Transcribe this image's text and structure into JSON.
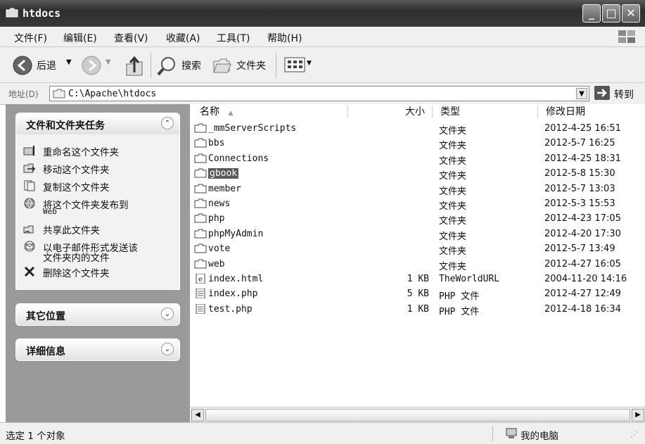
{
  "window": {
    "title": "htdocs"
  },
  "menu": [
    "文件(F)",
    "编辑(E)",
    "查看(V)",
    "收藏(A)",
    "工具(T)",
    "帮助(H)"
  ],
  "toolbar": {
    "back": "后退",
    "search": "搜索",
    "folders": "文件夹"
  },
  "address": {
    "label": "地址(D)",
    "value": "C:\\Apache\\htdocs",
    "go": "转到"
  },
  "tasks_panel": {
    "title": "文件和文件夹任务",
    "items": [
      {
        "label": "重命名这个文件夹",
        "icon": "rename-icon"
      },
      {
        "label": "移动这个文件夹",
        "icon": "move-icon"
      },
      {
        "label": "复制这个文件夹",
        "icon": "copy-icon"
      },
      {
        "label": "将这个文件夹发布到",
        "sub": "Web",
        "icon": "publish-web-icon"
      },
      {
        "label": "共享此文件夹",
        "icon": "share-icon"
      },
      {
        "label": "以电子邮件形式发送该",
        "label2": "文件夹内的文件",
        "icon": "email-icon"
      },
      {
        "label": "删除这个文件夹",
        "icon": "delete-icon"
      }
    ]
  },
  "other_places": {
    "title": "其它位置"
  },
  "details": {
    "title": "详细信息"
  },
  "columns": {
    "name": "名称",
    "size": "大小",
    "type": "类型",
    "modified": "修改日期"
  },
  "files": [
    {
      "name": "_mmServerScripts",
      "size": "",
      "type": "文件夹",
      "date": "2012-4-25 16:51",
      "icon": "folder-icon"
    },
    {
      "name": "bbs",
      "size": "",
      "type": "文件夹",
      "date": "2012-5-7 16:25",
      "icon": "folder-icon"
    },
    {
      "name": "Connections",
      "size": "",
      "type": "文件夹",
      "date": "2012-4-25 18:31",
      "icon": "folder-icon"
    },
    {
      "name": "gbook",
      "size": "",
      "type": "文件夹",
      "date": "2012-5-8 15:30",
      "icon": "folder-icon",
      "selected": true
    },
    {
      "name": "member",
      "size": "",
      "type": "文件夹",
      "date": "2012-5-7 13:03",
      "icon": "folder-icon"
    },
    {
      "name": "news",
      "size": "",
      "type": "文件夹",
      "date": "2012-5-3 15:53",
      "icon": "folder-icon"
    },
    {
      "name": "php",
      "size": "",
      "type": "文件夹",
      "date": "2012-4-23 17:05",
      "icon": "folder-icon"
    },
    {
      "name": "phpMyAdmin",
      "size": "",
      "type": "文件夹",
      "date": "2012-4-20 17:30",
      "icon": "folder-icon"
    },
    {
      "name": "vote",
      "size": "",
      "type": "文件夹",
      "date": "2012-5-7 13:49",
      "icon": "folder-icon"
    },
    {
      "name": "web",
      "size": "",
      "type": "文件夹",
      "date": "2012-4-27 16:05",
      "icon": "folder-icon"
    },
    {
      "name": "index.html",
      "size": "1 KB",
      "type": "TheWorldURL",
      "date": "2004-11-20 14:16",
      "icon": "html-file-icon"
    },
    {
      "name": "index.php",
      "size": "5 KB",
      "type": "PHP 文件",
      "date": "2012-4-27 12:49",
      "icon": "php-file-icon"
    },
    {
      "name": "test.php",
      "size": "1 KB",
      "type": "PHP 文件",
      "date": "2012-4-18 16:34",
      "icon": "php-file-icon"
    }
  ],
  "status": {
    "text": "选定 1 个对象",
    "location": "我的电脑"
  }
}
